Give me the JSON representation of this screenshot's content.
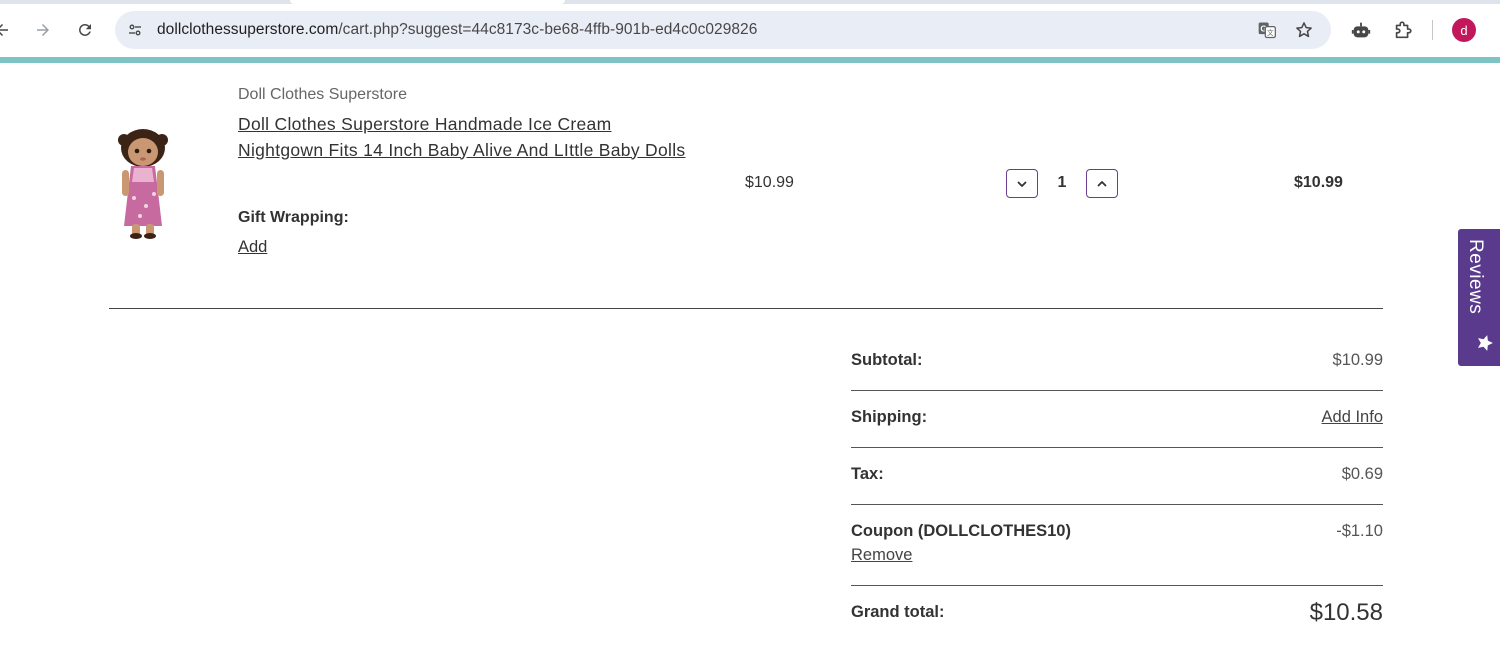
{
  "browser": {
    "url_domain": "dollclothessuperstore.com",
    "url_path": "/cart.php?suggest=44c8173c-be68-4ffb-901b-ed4c0c029826",
    "profile_initial": "d",
    "icons": [
      "back-icon",
      "forward-icon",
      "reload-icon",
      "site-info-icon",
      "translate-icon",
      "bookmark-star-icon",
      "extension-robot-icon",
      "extensions-puzzle-icon"
    ]
  },
  "cart_item": {
    "brand": "Doll Clothes Superstore",
    "title": "Doll Clothes Superstore Handmade Ice Cream Nightgown Fits 14 Inch Baby Alive And LIttle Baby Dolls",
    "gift_wrapping_label": "Gift Wrapping:",
    "gift_wrapping_action": "Add",
    "unit_price": "$10.99",
    "quantity": "1",
    "line_total": "$10.99"
  },
  "totals": {
    "subtotal_label": "Subtotal:",
    "subtotal_value": "$10.99",
    "shipping_label": "Shipping:",
    "shipping_value": "Add Info",
    "tax_label": "Tax:",
    "tax_value": "$0.69",
    "coupon_label": "Coupon (DOLLCLOTHES10)",
    "coupon_value": "-$1.10",
    "coupon_remove": "Remove",
    "grand_label": "Grand total:",
    "grand_value": "$10.58"
  },
  "reviews_tab": {
    "label": "Reviews"
  },
  "colors": {
    "accent_bar": "#7ec4c4",
    "reviews_tab": "#5a3a8c",
    "qty_button_border": "#6a3d8f",
    "avatar": "#c2185b"
  }
}
